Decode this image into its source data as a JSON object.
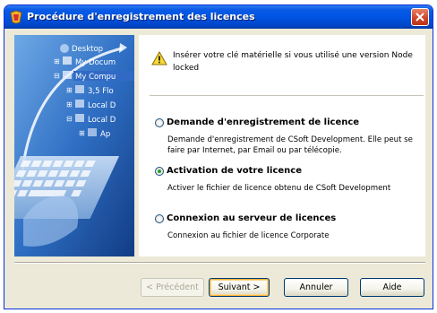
{
  "window": {
    "title": "Procédure d'enregistrement des licences"
  },
  "sidebar_tree": {
    "items": [
      {
        "label": "Desktop"
      },
      {
        "label": "My Docum"
      },
      {
        "label": "My Compu"
      },
      {
        "label": "3,5 Flo"
      },
      {
        "label": "Local D"
      },
      {
        "label": "Local D"
      },
      {
        "label": "Ap"
      }
    ]
  },
  "header": {
    "warning_text": "Insérer votre clé matérielle si vous utilisé une version Node locked"
  },
  "options": [
    {
      "title": "Demande d'enregistrement de licence",
      "description": "Demande d'enregistrement de CSoft Development. Elle peut se faire par Internet, par Email ou par télécopie.",
      "selected": false
    },
    {
      "title": "Activation de votre licence",
      "description": "Activer le fichier de licence obtenu de CSoft Development",
      "selected": true
    },
    {
      "title": "Connexion au serveur de licences",
      "description": "Connexion au fichier de licence Corporate",
      "selected": false
    }
  ],
  "buttons": {
    "previous": "< Précédent",
    "next": "Suivant >",
    "cancel": "Annuler",
    "help": "Aide"
  },
  "colors": {
    "titlebar": "#0054E3",
    "dialog_bg": "#ECE9D8",
    "radio_selected": "#21A121"
  }
}
